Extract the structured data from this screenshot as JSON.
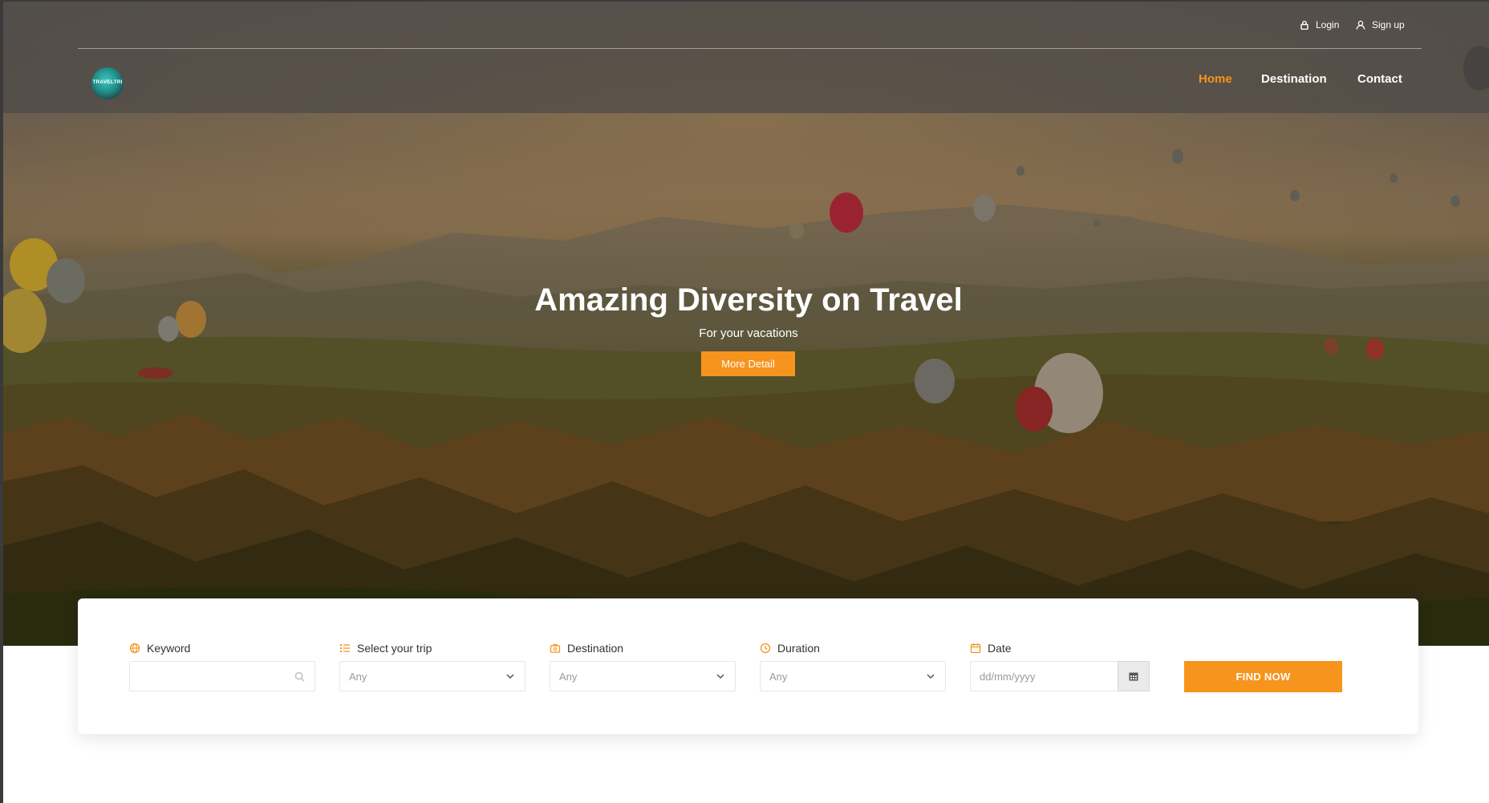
{
  "header": {
    "top_links": {
      "login": "Login",
      "signup": "Sign up"
    },
    "logo_text": "TRAVELTRI",
    "nav": [
      {
        "label": "Home",
        "active": true
      },
      {
        "label": "Destination",
        "active": false
      },
      {
        "label": "Contact",
        "active": false
      }
    ]
  },
  "hero": {
    "title": "Amazing Diversity on Travel",
    "subtitle": "For your vacations",
    "button": "More Detail"
  },
  "search": {
    "fields": [
      {
        "label": "Keyword",
        "icon": "globe-icon",
        "value": "",
        "placeholder": ""
      },
      {
        "label": "Select your trip",
        "icon": "list-icon",
        "value": "Any"
      },
      {
        "label": "Destination",
        "icon": "suitcase-icon",
        "value": "Any"
      },
      {
        "label": "Duration",
        "icon": "clock-icon",
        "value": "Any"
      },
      {
        "label": "Date",
        "icon": "calendar-icon",
        "placeholder": "dd/mm/yyyy"
      }
    ],
    "submit": "FIND NOW"
  },
  "colors": {
    "accent": "#f7941d",
    "header_overlay": "#4e4a46"
  }
}
